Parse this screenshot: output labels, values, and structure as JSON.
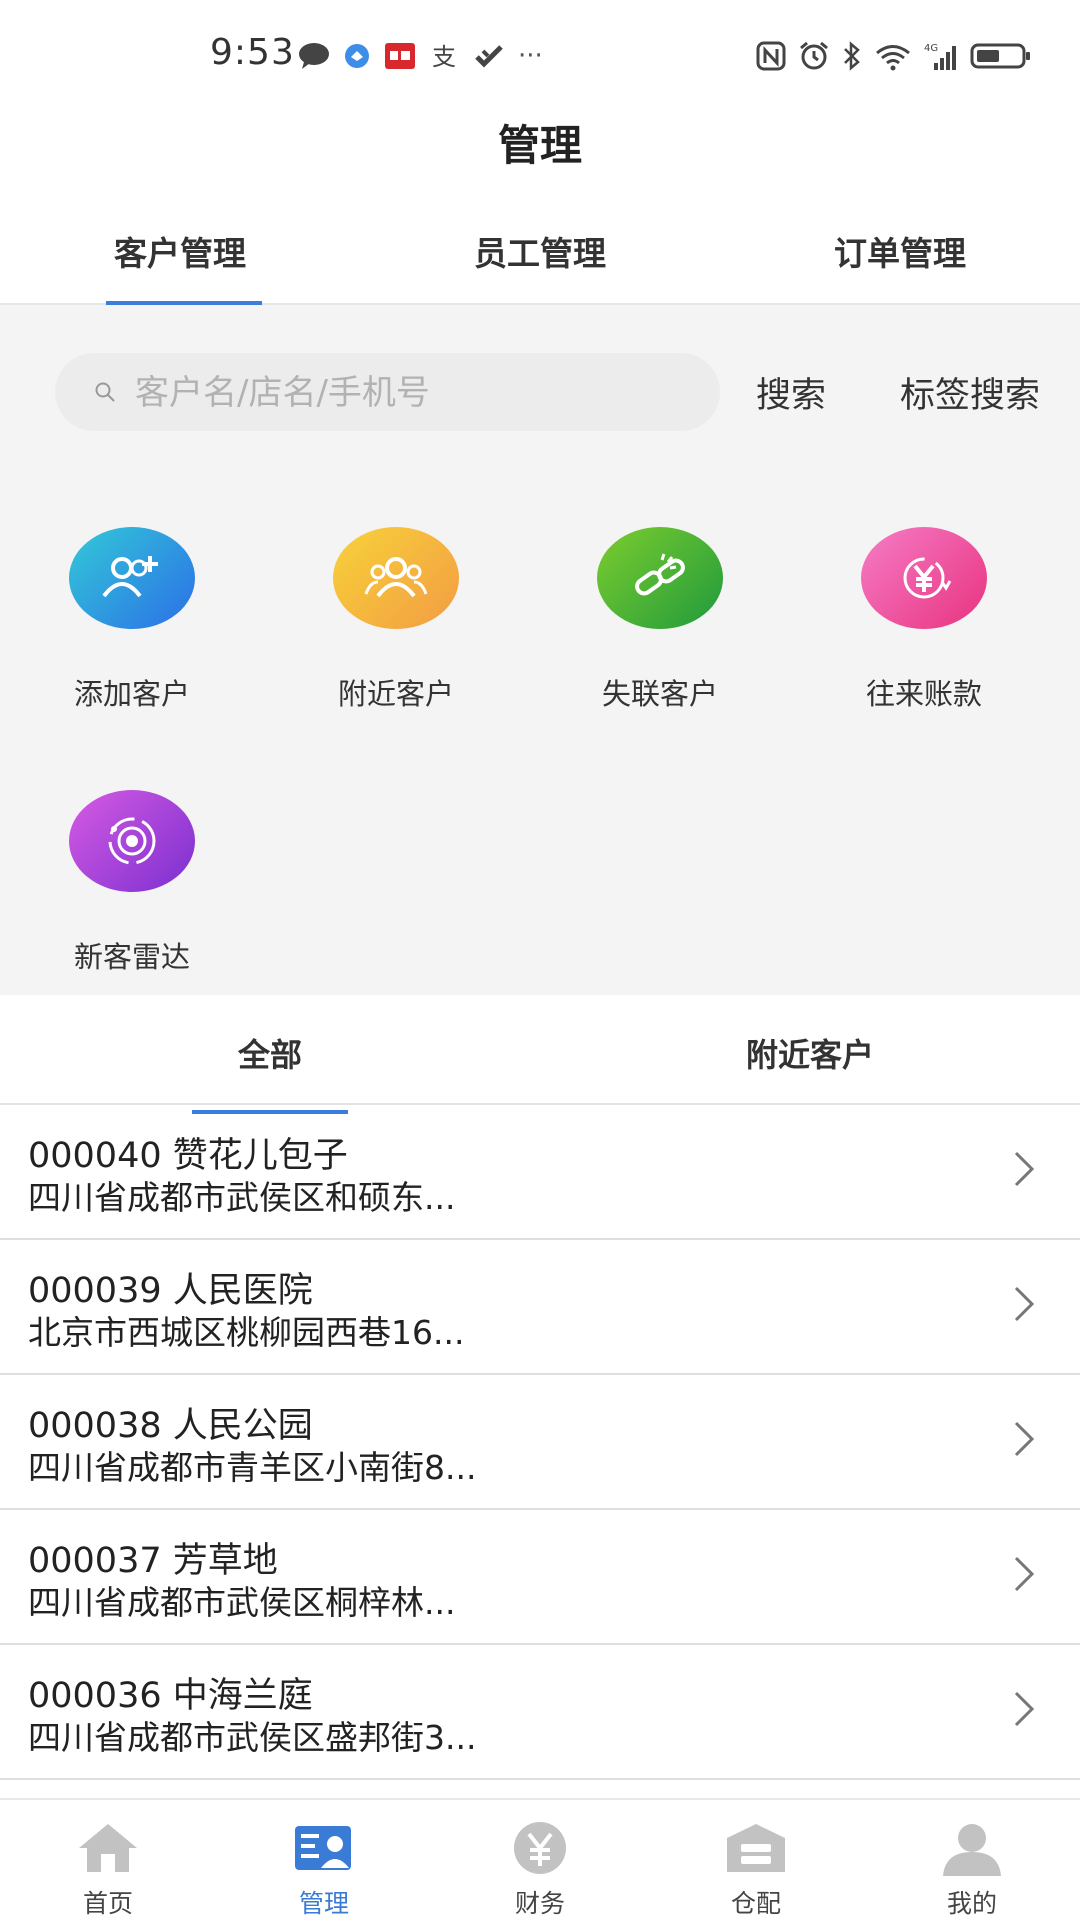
{
  "status_bar": {
    "time": "9:53",
    "left_icons": [
      "chat-icon",
      "app-icon",
      "app-icon-red",
      "alipay-icon",
      "checkmark-app-icon",
      "more-dots-icon"
    ],
    "more": "···",
    "right_icons": [
      "nfc-icon",
      "alarm-icon",
      "bluetooth-icon",
      "wifi-icon",
      "signal-icon",
      "battery-icon"
    ]
  },
  "header": {
    "title": "管理"
  },
  "top_tabs": [
    {
      "label": "客户管理",
      "active": true
    },
    {
      "label": "员工管理",
      "active": false
    },
    {
      "label": "订单管理",
      "active": false
    }
  ],
  "search": {
    "placeholder": "客户名/店名/手机号",
    "value": "",
    "search_label": "搜索",
    "tag_search_label": "标签搜索"
  },
  "actions": [
    {
      "label": "添加客户",
      "icon": "add-user-icon",
      "color": "#2f86e8"
    },
    {
      "label": "附近客户",
      "icon": "group-icon",
      "color": "#f5b437"
    },
    {
      "label": "失联客户",
      "icon": "broken-link-icon",
      "color": "#3fa93a"
    },
    {
      "label": "往来账款",
      "icon": "yuan-exchange-icon",
      "color": "#ec4f9f"
    },
    {
      "label": "新客雷达",
      "icon": "radar-icon",
      "color": "#9b46d6"
    }
  ],
  "sub_tabs": [
    {
      "label": "全部",
      "active": true
    },
    {
      "label": "附近客户",
      "active": false
    }
  ],
  "customers": [
    {
      "title": "000040 赞花儿包子",
      "address": "四川省成都市武侯区和硕东..."
    },
    {
      "title": "000039 人民医院",
      "address": "北京市西城区桃柳园西巷16..."
    },
    {
      "title": "000038 人民公园",
      "address": "四川省成都市青羊区小南街8..."
    },
    {
      "title": "000037 芳草地",
      "address": "四川省成都市武侯区桐梓林..."
    },
    {
      "title": "000036 中海兰庭",
      "address": "四川省成都市武侯区盛邦街3..."
    }
  ],
  "bottom_nav": [
    {
      "label": "首页",
      "icon": "home-icon",
      "active": false
    },
    {
      "label": "管理",
      "icon": "management-icon",
      "active": true
    },
    {
      "label": "财务",
      "icon": "finance-yuan-icon",
      "active": false
    },
    {
      "label": "仓配",
      "icon": "warehouse-icon",
      "active": false
    },
    {
      "label": "我的",
      "icon": "profile-icon",
      "active": false
    }
  ],
  "colors": {
    "accent": "#3b7ddd",
    "nav_active": "#3a7bd5",
    "background_grey": "#f4f4f4"
  }
}
